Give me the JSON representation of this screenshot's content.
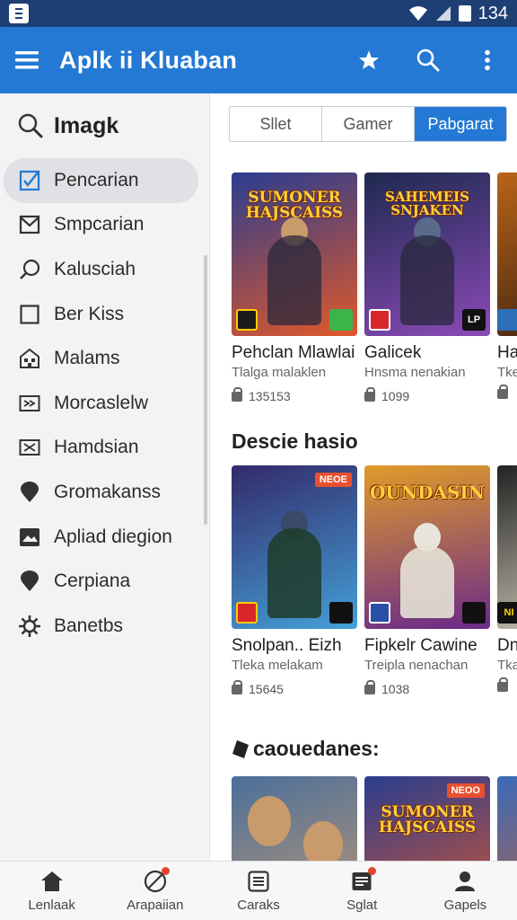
{
  "status_bar": {
    "time": "134"
  },
  "app_bar": {
    "title": "Aplk ii Kluaban",
    "menu_icon": "hamburger-icon",
    "actions": [
      "star-icon",
      "search-icon",
      "more-vert-icon"
    ]
  },
  "drawer": {
    "search_label": "Imagk",
    "items": [
      {
        "label": "Pencarian",
        "icon": "checkbox-icon",
        "active": true
      },
      {
        "label": "Smpcarian",
        "icon": "mail-icon"
      },
      {
        "label": "Kalusciah",
        "icon": "search-loop-icon"
      },
      {
        "label": "Ber Kiss",
        "icon": "square-icon"
      },
      {
        "label": "Malams",
        "icon": "building-icon"
      },
      {
        "label": "Morcaslelw",
        "icon": "ticket-icon"
      },
      {
        "label": "Hamdsian",
        "icon": "ticket-icon"
      },
      {
        "label": "Gromakanss",
        "icon": "pin-icon"
      },
      {
        "label": "Apliad diegion",
        "icon": "image-icon"
      },
      {
        "label": "Cerpiana",
        "icon": "pin-icon"
      },
      {
        "label": "Banetbs",
        "icon": "gear-icon"
      }
    ]
  },
  "segment": {
    "options": [
      "Sllet",
      "Gamer",
      "Pabgarat"
    ],
    "selected": 2
  },
  "sections": [
    {
      "title": "",
      "cards": [
        {
          "art_title": "SUMONER HAJSCAISS",
          "name": "Pehclan Mlawlai",
          "dev": "Tlalga malaklen",
          "downloads": "135153",
          "badge_r": "",
          "bg": "#2a3d8f",
          "bg2": "#e0582a"
        },
        {
          "art_title": "SAHEMEIS SNJAKEN",
          "name": "Galicek",
          "dev": "Hnsma nenakian",
          "downloads": "1099",
          "badge_r": "LP",
          "bg": "#1d2a4f",
          "bg2": "#8c4ab8"
        },
        {
          "art_title": "",
          "name": "Ha",
          "dev": "Tke",
          "downloads": "",
          "badge_r": "",
          "bg": "#b86418",
          "bg2": "#3a2010"
        }
      ]
    },
    {
      "title": "Descie hasio",
      "cards": [
        {
          "art_title": "",
          "tag": "NEOE",
          "name": "Snolpan.. Eizh",
          "dev": "Tleka melakam",
          "downloads": "15645",
          "badge_r": "",
          "bg": "#332a6a",
          "bg2": "#44a0d8"
        },
        {
          "art_title": "OUNDASIN",
          "name": "Fipkelr Cawine",
          "dev": "Treipla nenachan",
          "downloads": "1038",
          "badge_r": "",
          "bg": "#e09a2a",
          "bg2": "#6a2a8a"
        },
        {
          "art_title": "",
          "name": "Dn",
          "dev": "Tka",
          "downloads": "",
          "badge_r": "NI",
          "bg": "#222222",
          "bg2": "#d8d2c0"
        }
      ]
    },
    {
      "title": "caouedanes:",
      "cards": [
        {
          "art_title": "",
          "name": "",
          "dev": "",
          "downloads": "",
          "badge_r": "",
          "bg": "#4a6f9a",
          "bg2": "#c69b72"
        },
        {
          "art_title": "SUMONER HAJSCAISS",
          "tag": "NEOO",
          "name": "",
          "dev": "",
          "downloads": "",
          "badge_r": "",
          "bg": "#2a3d8f",
          "bg2": "#e0582a"
        },
        {
          "art_title": "",
          "name": "",
          "dev": "",
          "downloads": "",
          "badge_r": "",
          "bg": "#3a6ab8",
          "bg2": "#d06030"
        }
      ]
    }
  ],
  "bottom_nav": [
    {
      "label": "Lenlaak",
      "icon": "home-icon",
      "badge": false
    },
    {
      "label": "Arapaiian",
      "icon": "compass-icon",
      "badge": true
    },
    {
      "label": "Caraks",
      "icon": "list-icon",
      "badge": false
    },
    {
      "label": "Sglat",
      "icon": "news-icon",
      "badge": true
    },
    {
      "label": "Gapels",
      "icon": "person-icon",
      "badge": false
    }
  ],
  "colors": {
    "primary": "#2379d3",
    "status_bar": "#1d3f73",
    "drawer_bg": "#f3f3f4"
  }
}
